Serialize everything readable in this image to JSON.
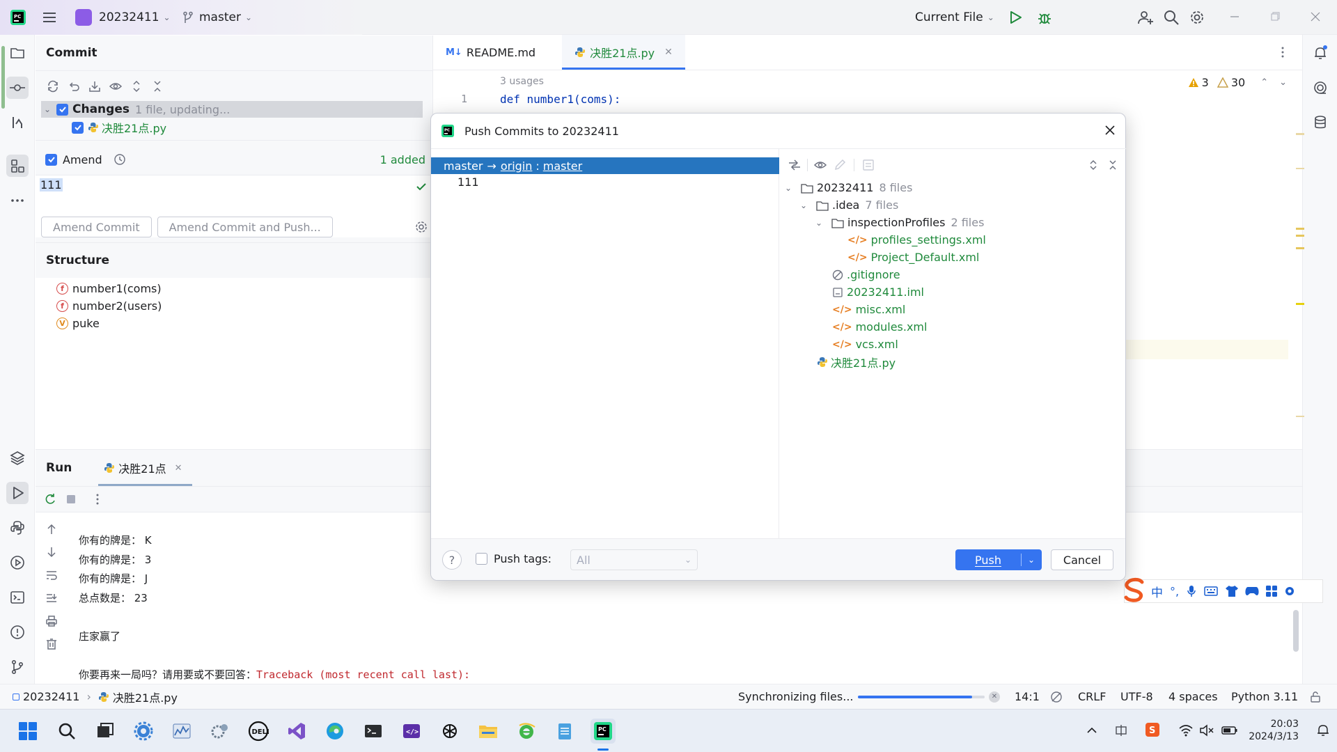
{
  "titlebar": {
    "project": "20232411",
    "branch": "master",
    "run_config": "Current File"
  },
  "commit_panel": {
    "title": "Commit",
    "changes_label": "Changes",
    "changes_meta": "1 file, updating...",
    "changed_file": "决胜21点.py",
    "amend_label": "Amend",
    "added_count": "1 added",
    "message": "111",
    "amend_commit_button": "Amend Commit",
    "amend_push_button": "Amend Commit and Push..."
  },
  "structure_panel": {
    "title": "Structure",
    "items": [
      {
        "kind": "f",
        "name": "number1(coms)"
      },
      {
        "kind": "f",
        "name": "number2(users)"
      },
      {
        "kind": "v",
        "name": "puke"
      }
    ]
  },
  "editor": {
    "tabs": [
      {
        "label": "README.md",
        "icon": "markdown-icon"
      },
      {
        "label": "决胜21点.py",
        "icon": "python-icon",
        "active": true
      }
    ],
    "usages_hint": "3 usages",
    "line_number": "1",
    "code_line": "def number1(coms):",
    "warnings": "3",
    "weak_warnings": "30"
  },
  "push_dialog": {
    "title": "Push Commits to 20232411",
    "branch_source": "master",
    "branch_arrow": "→",
    "branch_remote": "origin",
    "branch_sep": ":",
    "branch_target": "master",
    "commit_message": "111",
    "tree": {
      "root": {
        "name": "20232411",
        "meta": "8 files"
      },
      "idea": {
        "name": ".idea",
        "meta": "7 files"
      },
      "inspection": {
        "name": "inspectionProfiles",
        "meta": "2 files"
      },
      "files": {
        "profiles_settings": "profiles_settings.xml",
        "project_default": "Project_Default.xml",
        "gitignore": ".gitignore",
        "iml": "20232411.iml",
        "misc": "misc.xml",
        "modules": "modules.xml",
        "vcs": "vcs.xml",
        "py": "决胜21点.py"
      }
    },
    "push_tags_label": "Push tags:",
    "push_tags_value": "All",
    "push_button": "Push",
    "cancel_button": "Cancel"
  },
  "run_panel": {
    "title": "Run",
    "tab_label": "决胜21点",
    "output": [
      "你有的牌是： K",
      "你有的牌是： 3",
      "你有的牌是： J",
      "总点数是： 23",
      "",
      "庄家赢了",
      ""
    ],
    "prompt_line": "你要再来一局吗？请用要或不要回答：",
    "traceback": "Traceback (most recent call last):"
  },
  "statusbar": {
    "project": "20232411",
    "file": "决胜21点.py",
    "sync_text": "Synchronizing files...",
    "sync_progress": 0.9,
    "position": "14:1",
    "line_sep": "CRLF",
    "encoding": "UTF-8",
    "indent": "4 spaces",
    "interpreter": "Python 3.11"
  },
  "taskbar": {
    "time": "20:03",
    "date": "2024/3/13"
  },
  "ime": {
    "lang": "中"
  },
  "colors": {
    "accent": "#3574f0",
    "selection": "#2675bf",
    "project_badge": "#8c5ce6",
    "warning": "#e6a100",
    "green_file": "#208a3c"
  }
}
